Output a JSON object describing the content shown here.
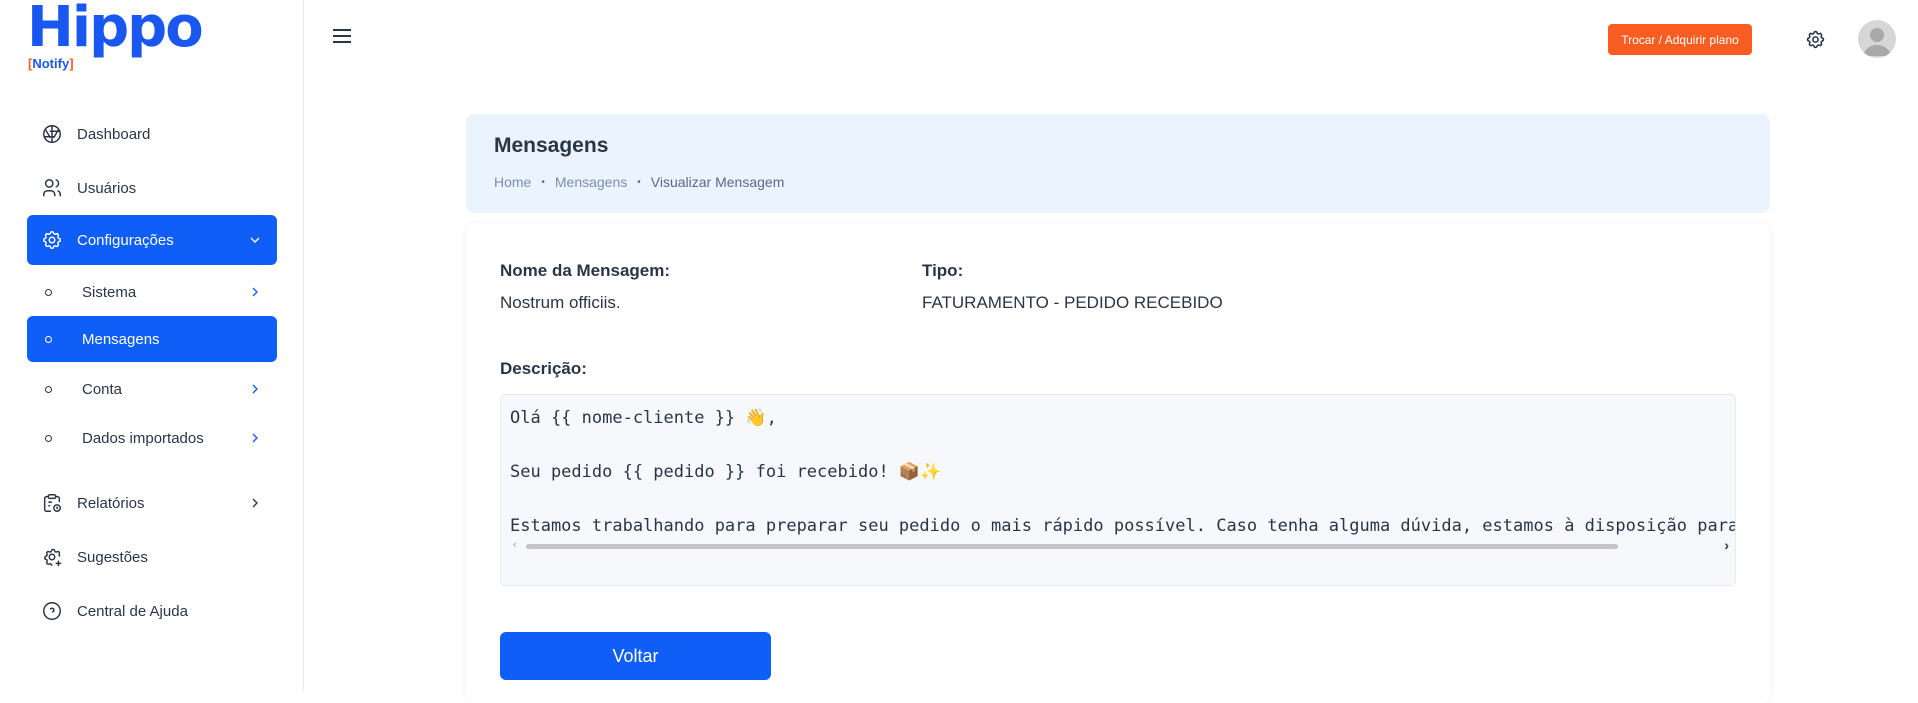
{
  "brand": {
    "logo_main": "Hippo",
    "logo_sub_open": "[",
    "logo_sub": "Notify",
    "logo_sub_close": "]"
  },
  "sidebar": {
    "items": [
      {
        "label": "Dashboard",
        "icon": "aperture-icon"
      },
      {
        "label": "Usuários",
        "icon": "users-icon"
      },
      {
        "label": "Configurações",
        "icon": "settings-icon",
        "expanded": true
      },
      {
        "label": "Relatórios",
        "icon": "report-clock-icon"
      },
      {
        "label": "Sugestões",
        "icon": "settings-plus-icon"
      },
      {
        "label": "Central de Ajuda",
        "icon": "help-circle-icon"
      }
    ],
    "subitems": [
      {
        "label": "Sistema"
      },
      {
        "label": "Mensagens",
        "active": true
      },
      {
        "label": "Conta"
      },
      {
        "label": "Dados importados"
      }
    ]
  },
  "topbar": {
    "plan_button": "Trocar / Adquirir plano"
  },
  "header": {
    "title": "Mensagens",
    "breadcrumb": [
      "Home",
      "Mensagens",
      "Visualizar Mensagem"
    ],
    "separator": "•"
  },
  "details": {
    "name_label": "Nome da Mensagem:",
    "name_value": "Nostrum officiis.",
    "type_label": "Tipo:",
    "type_value": "FATURAMENTO - PEDIDO RECEBIDO",
    "description_label": "Descrição:",
    "description_lines": [
      "Olá {{ nome-cliente }} 👋,",
      "Seu pedido {{ pedido }} foi recebido! 📦✨",
      "Estamos trabalhando para preparar seu pedido o mais rápido possível. Caso tenha alguma dúvida, estamos à disposição para a"
    ]
  },
  "actions": {
    "back_label": "Voltar"
  },
  "colors": {
    "primary": "#0f5ef7",
    "accent": "#fa5d21",
    "header_bg": "#ebf3fe",
    "text": "#2a3547"
  }
}
